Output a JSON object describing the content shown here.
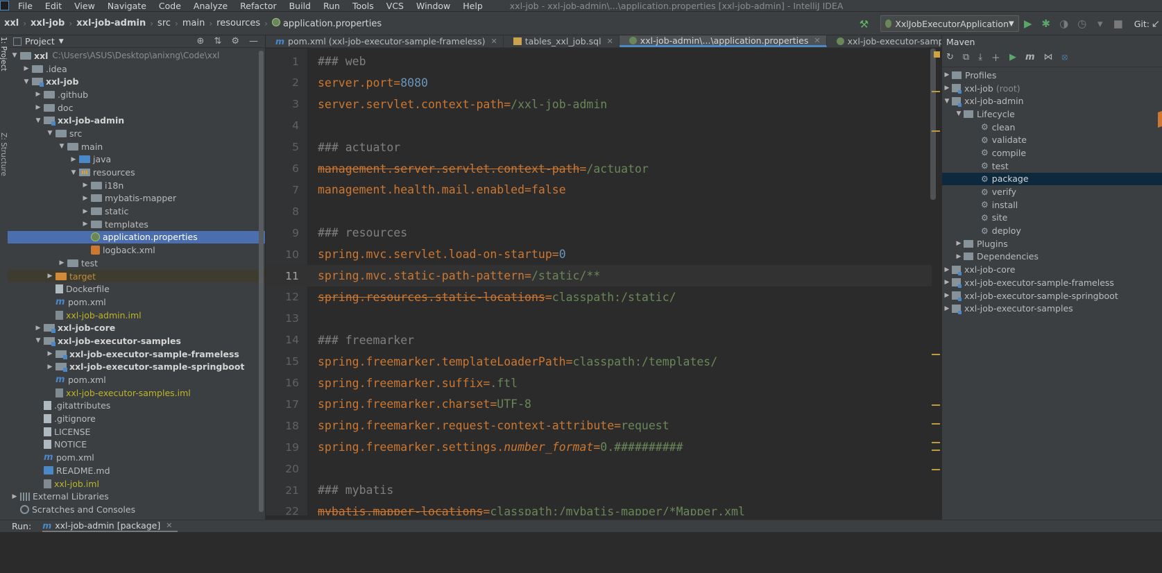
{
  "menu": [
    "File",
    "Edit",
    "View",
    "Navigate",
    "Code",
    "Analyze",
    "Refactor",
    "Build",
    "Run",
    "Tools",
    "VCS",
    "Window",
    "Help"
  ],
  "window_title": "xxl-job - xxl-job-admin\\...\\application.properties [xxl-job-admin] - IntelliJ IDEA",
  "breadcrumb": [
    "xxl",
    "xxl-job",
    "xxl-job-admin",
    "src",
    "main",
    "resources",
    "application.properties"
  ],
  "run_config": "XxlJobExecutorApplication",
  "git_label": "Git:",
  "left_stripe": {
    "project": "1: Project",
    "structure": "Z: Structure"
  },
  "project_panel": {
    "title": "Project",
    "tree": [
      {
        "label": "xxl",
        "path": "C:\\Users\\ASUS\\Desktop\\anixng\\Code\\xxl",
        "depth": 0,
        "arrow": "down",
        "icon": "folder",
        "style": "bold"
      },
      {
        "label": ".idea",
        "depth": 1,
        "arrow": "right",
        "icon": "folder"
      },
      {
        "label": "xxl-job",
        "depth": 1,
        "arrow": "down",
        "icon": "module",
        "style": "bold"
      },
      {
        "label": ".github",
        "depth": 2,
        "arrow": "right",
        "icon": "folder"
      },
      {
        "label": "doc",
        "depth": 2,
        "arrow": "right",
        "icon": "folder"
      },
      {
        "label": "xxl-job-admin",
        "depth": 2,
        "arrow": "down",
        "icon": "module",
        "style": "bold"
      },
      {
        "label": "src",
        "depth": 3,
        "arrow": "down",
        "icon": "folder"
      },
      {
        "label": "main",
        "depth": 4,
        "arrow": "down",
        "icon": "folder"
      },
      {
        "label": "java",
        "depth": 5,
        "arrow": "right",
        "icon": "folder-blue"
      },
      {
        "label": "resources",
        "depth": 5,
        "arrow": "down",
        "icon": "resources"
      },
      {
        "label": "i18n",
        "depth": 6,
        "arrow": "right",
        "icon": "folder"
      },
      {
        "label": "mybatis-mapper",
        "depth": 6,
        "arrow": "right",
        "icon": "folder"
      },
      {
        "label": "static",
        "depth": 6,
        "arrow": "right",
        "icon": "folder"
      },
      {
        "label": "templates",
        "depth": 6,
        "arrow": "right",
        "icon": "folder"
      },
      {
        "label": "application.properties",
        "depth": 6,
        "arrow": "none",
        "icon": "properties",
        "selected": true
      },
      {
        "label": "logback.xml",
        "depth": 6,
        "arrow": "none",
        "icon": "xml"
      },
      {
        "label": "test",
        "depth": 4,
        "arrow": "right",
        "icon": "folder"
      },
      {
        "label": "target",
        "depth": 3,
        "arrow": "right",
        "icon": "folder-orange",
        "style": "orange",
        "target": true
      },
      {
        "label": "Dockerfile",
        "depth": 3,
        "arrow": "none",
        "icon": "file"
      },
      {
        "label": "pom.xml",
        "depth": 3,
        "arrow": "none",
        "icon": "maven"
      },
      {
        "label": "xxl-job-admin.iml",
        "depth": 3,
        "arrow": "none",
        "icon": "iml",
        "style": "yellow"
      },
      {
        "label": "xxl-job-core",
        "depth": 2,
        "arrow": "right",
        "icon": "module",
        "style": "bold"
      },
      {
        "label": "xxl-job-executor-samples",
        "depth": 2,
        "arrow": "down",
        "icon": "module",
        "style": "bold"
      },
      {
        "label": "xxl-job-executor-sample-frameless",
        "depth": 3,
        "arrow": "right",
        "icon": "module",
        "style": "bold"
      },
      {
        "label": "xxl-job-executor-sample-springboot",
        "depth": 3,
        "arrow": "right",
        "icon": "module",
        "style": "bold"
      },
      {
        "label": "pom.xml",
        "depth": 3,
        "arrow": "none",
        "icon": "maven"
      },
      {
        "label": "xxl-job-executor-samples.iml",
        "depth": 3,
        "arrow": "none",
        "icon": "iml",
        "style": "yellow"
      },
      {
        "label": ".gitattributes",
        "depth": 2,
        "arrow": "none",
        "icon": "file"
      },
      {
        "label": ".gitignore",
        "depth": 2,
        "arrow": "none",
        "icon": "file"
      },
      {
        "label": "LICENSE",
        "depth": 2,
        "arrow": "none",
        "icon": "file"
      },
      {
        "label": "NOTICE",
        "depth": 2,
        "arrow": "none",
        "icon": "file"
      },
      {
        "label": "pom.xml",
        "depth": 2,
        "arrow": "none",
        "icon": "maven"
      },
      {
        "label": "README.md",
        "depth": 2,
        "arrow": "none",
        "icon": "md"
      },
      {
        "label": "xxl-job.iml",
        "depth": 2,
        "arrow": "none",
        "icon": "iml",
        "style": "yellow"
      },
      {
        "label": "External Libraries",
        "depth": 0,
        "arrow": "right",
        "icon": "library"
      },
      {
        "label": "Scratches and Consoles",
        "depth": 0,
        "arrow": "none",
        "icon": "scratch"
      }
    ]
  },
  "editor_tabs": [
    {
      "label": "pom.xml (xxl-job-executor-sample-frameless)",
      "icon": "maven",
      "closable": true
    },
    {
      "label": "tables_xxl_job.sql",
      "icon": "table",
      "closable": true
    },
    {
      "label": "xxl-job-admin\\...\\application.properties",
      "icon": "properties",
      "closable": true,
      "active": true
    },
    {
      "label": "xxl-job-executor-sample-springboot\\...\\:",
      "icon": "properties",
      "closable": false
    }
  ],
  "current_line": 11,
  "code_lines": [
    {
      "n": "1",
      "tokens": [
        {
          "t": "c",
          "v": "### web"
        }
      ]
    },
    {
      "n": "2",
      "tokens": [
        {
          "t": "k",
          "v": "server.port"
        },
        {
          "t": "o",
          "v": "="
        },
        {
          "t": "n",
          "v": "8080"
        }
      ]
    },
    {
      "n": "3",
      "tokens": [
        {
          "t": "k",
          "v": "server.servlet.context-path"
        },
        {
          "t": "o",
          "v": "="
        },
        {
          "t": "v",
          "v": "/xxl-job-admin"
        }
      ]
    },
    {
      "n": "4",
      "tokens": []
    },
    {
      "n": "5",
      "tokens": [
        {
          "t": "c",
          "v": "### actuator"
        }
      ]
    },
    {
      "n": "6",
      "tokens": [
        {
          "t": "ks",
          "v": "management.server.servlet.context-path"
        },
        {
          "t": "o",
          "v": "="
        },
        {
          "t": "v",
          "v": "/actuator"
        }
      ]
    },
    {
      "n": "7",
      "tokens": [
        {
          "t": "k",
          "v": "management.health.mail.enabled"
        },
        {
          "t": "o",
          "v": "="
        },
        {
          "t": "vo",
          "v": "false"
        }
      ]
    },
    {
      "n": "8",
      "tokens": []
    },
    {
      "n": "9",
      "tokens": [
        {
          "t": "c",
          "v": "### resources"
        }
      ]
    },
    {
      "n": "10",
      "tokens": [
        {
          "t": "k",
          "v": "spring.mvc.servlet.load-on-startup"
        },
        {
          "t": "o",
          "v": "="
        },
        {
          "t": "n",
          "v": "0"
        }
      ]
    },
    {
      "n": "11",
      "tokens": [
        {
          "t": "k",
          "v": "spring.mvc.static-path-pattern"
        },
        {
          "t": "o",
          "v": "="
        },
        {
          "t": "v",
          "v": "/static/**"
        }
      ]
    },
    {
      "n": "12",
      "tokens": [
        {
          "t": "ks",
          "v": "spring.resources.static-locations"
        },
        {
          "t": "o",
          "v": "="
        },
        {
          "t": "v",
          "v": "classpath:/static/"
        }
      ]
    },
    {
      "n": "13",
      "tokens": []
    },
    {
      "n": "14",
      "tokens": [
        {
          "t": "c",
          "v": "### freemarker"
        }
      ]
    },
    {
      "n": "15",
      "tokens": [
        {
          "t": "k",
          "v": "spring.freemarker.templateLoaderPath"
        },
        {
          "t": "o",
          "v": "="
        },
        {
          "t": "v",
          "v": "classpath:/templates/"
        }
      ]
    },
    {
      "n": "16",
      "tokens": [
        {
          "t": "k",
          "v": "spring.freemarker.suffix"
        },
        {
          "t": "o",
          "v": "="
        },
        {
          "t": "v",
          "v": ".ftl"
        }
      ]
    },
    {
      "n": "17",
      "tokens": [
        {
          "t": "k",
          "v": "spring.freemarker.charset"
        },
        {
          "t": "o",
          "v": "="
        },
        {
          "t": "v",
          "v": "UTF-8"
        }
      ]
    },
    {
      "n": "18",
      "tokens": [
        {
          "t": "k",
          "v": "spring.freemarker.request-context-attribute"
        },
        {
          "t": "o",
          "v": "="
        },
        {
          "t": "v",
          "v": "request"
        }
      ]
    },
    {
      "n": "19",
      "tokens": [
        {
          "t": "k",
          "v": "spring.freemarker.settings."
        },
        {
          "t": "ki",
          "v": "number_format"
        },
        {
          "t": "o",
          "v": "="
        },
        {
          "t": "v",
          "v": "0.##########"
        }
      ]
    },
    {
      "n": "20",
      "tokens": []
    },
    {
      "n": "21",
      "tokens": [
        {
          "t": "c",
          "v": "### mybatis"
        }
      ]
    },
    {
      "n": "22",
      "tokens": [
        {
          "t": "ks",
          "v": "mybatis.mapper-locations"
        },
        {
          "t": "o",
          "v": "="
        },
        {
          "t": "v",
          "v": "classpath:/mybatis-mapper/*Mapper.xml"
        }
      ]
    }
  ],
  "maven": {
    "title": "Maven",
    "tree": [
      {
        "label": "Profiles",
        "depth": 0,
        "arrow": "right",
        "icon": "folder"
      },
      {
        "label": "xxl-job",
        "suffix": "(root)",
        "depth": 0,
        "arrow": "right",
        "icon": "module"
      },
      {
        "label": "xxl-job-admin",
        "depth": 0,
        "arrow": "down",
        "icon": "module"
      },
      {
        "label": "Lifecycle",
        "depth": 1,
        "arrow": "down",
        "icon": "folder"
      },
      {
        "label": "clean",
        "depth": 2,
        "arrow": "none",
        "icon": "gear"
      },
      {
        "label": "validate",
        "depth": 2,
        "arrow": "none",
        "icon": "gear"
      },
      {
        "label": "compile",
        "depth": 2,
        "arrow": "none",
        "icon": "gear"
      },
      {
        "label": "test",
        "depth": 2,
        "arrow": "none",
        "icon": "gear"
      },
      {
        "label": "package",
        "depth": 2,
        "arrow": "none",
        "icon": "gear",
        "selected": true
      },
      {
        "label": "verify",
        "depth": 2,
        "arrow": "none",
        "icon": "gear"
      },
      {
        "label": "install",
        "depth": 2,
        "arrow": "none",
        "icon": "gear"
      },
      {
        "label": "site",
        "depth": 2,
        "arrow": "none",
        "icon": "gear"
      },
      {
        "label": "deploy",
        "depth": 2,
        "arrow": "none",
        "icon": "gear"
      },
      {
        "label": "Plugins",
        "depth": 1,
        "arrow": "right",
        "icon": "folder"
      },
      {
        "label": "Dependencies",
        "depth": 1,
        "arrow": "right",
        "icon": "folder"
      },
      {
        "label": "xxl-job-core",
        "depth": 0,
        "arrow": "right",
        "icon": "module"
      },
      {
        "label": "xxl-job-executor-sample-frameless",
        "depth": 0,
        "arrow": "right",
        "icon": "module"
      },
      {
        "label": "xxl-job-executor-sample-springboot",
        "depth": 0,
        "arrow": "right",
        "icon": "module"
      },
      {
        "label": "xxl-job-executor-samples",
        "depth": 0,
        "arrow": "right",
        "icon": "module"
      }
    ]
  },
  "run_bar": {
    "label": "Run:",
    "tab": "xxl-job-admin [package]"
  },
  "colors": {
    "selection": "#4b6eaf",
    "key": "#cc7832",
    "value": "#6a8759",
    "number": "#6897bb",
    "comment": "#808080",
    "background": "#2b2b2b"
  }
}
